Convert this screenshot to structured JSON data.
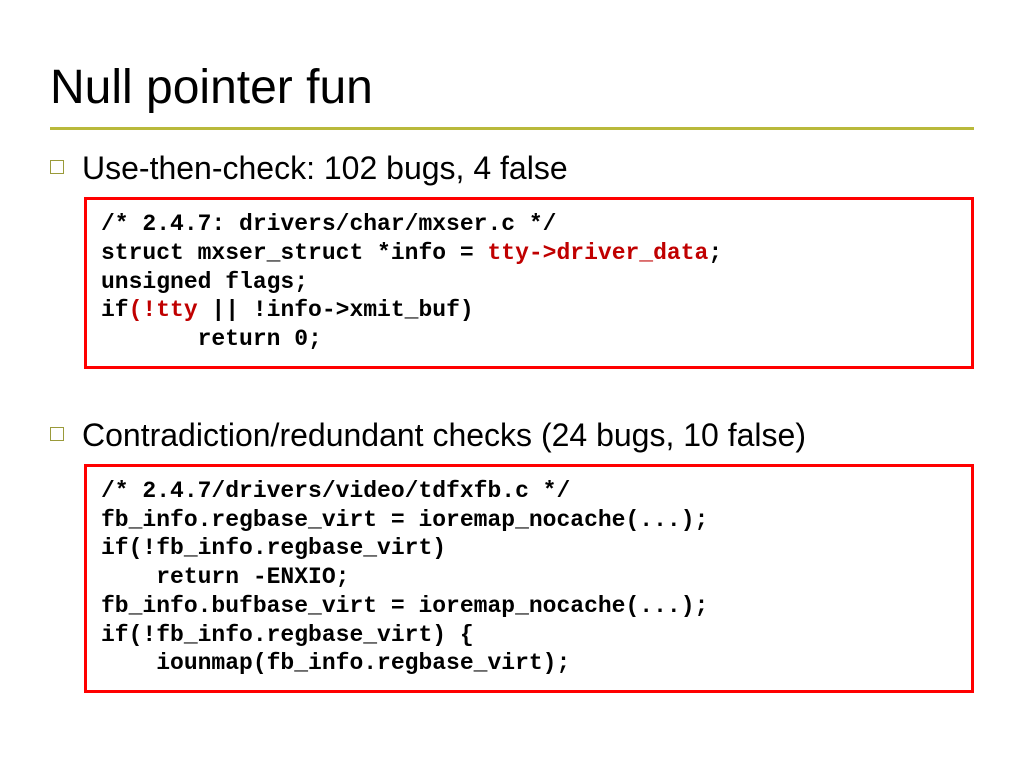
{
  "title": "Null pointer fun",
  "bullets": [
    {
      "text": "Use-then-check: 102 bugs, 4 false"
    },
    {
      "text": "Contradiction/redundant checks (24 bugs, 10 false)"
    }
  ],
  "code1": {
    "l1": "/* 2.4.7: drivers/char/mxser.c */",
    "l2a": "struct mxser_struct *info = ",
    "l2b": "tty->driver_data",
    "l2c": ";",
    "l3": "unsigned flags;",
    "l4a": "if",
    "l4b": "(!tty",
    "l4c": " || !info->xmit_buf)",
    "l5": "       return 0;"
  },
  "code2": {
    "l1": "/* 2.4.7/drivers/video/tdfxfb.c */",
    "l2": "fb_info.regbase_virt = ioremap_nocache(...);",
    "l3": "if(!fb_info.regbase_virt)",
    "l4": "    return -ENXIO;",
    "l5": "fb_info.bufbase_virt = ioremap_nocache(...);",
    "l6": "if(!fb_info.regbase_virt) {",
    "l7": "    iounmap(fb_info.regbase_virt);"
  }
}
